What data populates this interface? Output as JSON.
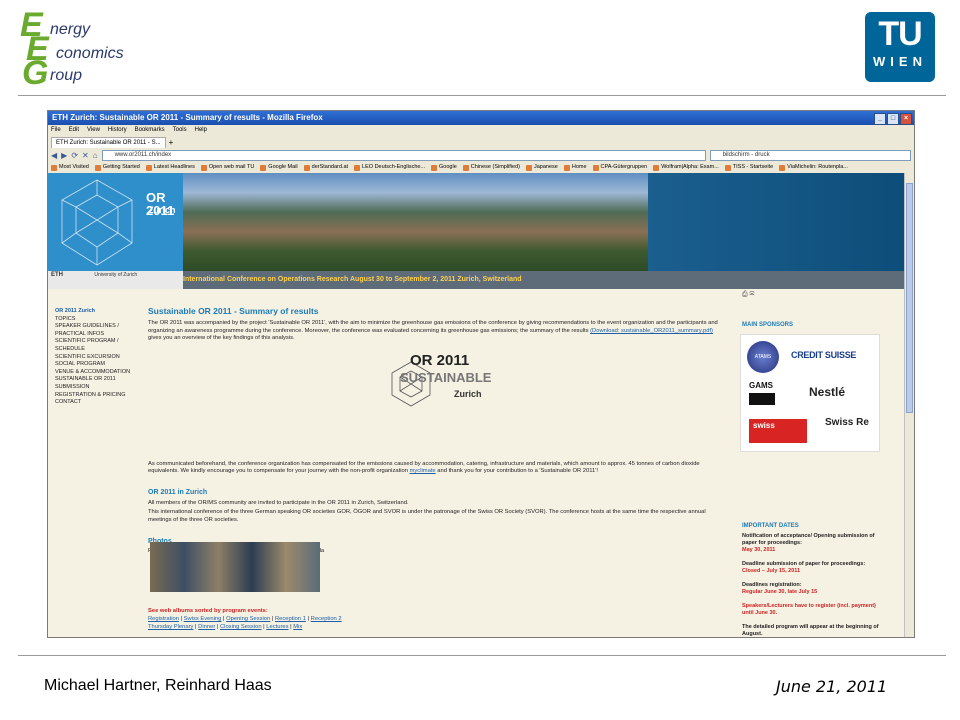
{
  "slide": {
    "logo_letters": [
      "E",
      "E",
      "G"
    ],
    "logo_words": [
      "nergy",
      "conomics",
      "roup"
    ],
    "tu_logo_top": "TU",
    "tu_logo_bottom": "WIEN",
    "authors": "Michael Hartner, Reinhard Haas",
    "date": "June 21, 2011"
  },
  "browser": {
    "window_title": "ETH Zurich: Sustainable OR 2011 - Summary of results - Mozilla Firefox",
    "window_buttons": [
      "_",
      "□",
      "×"
    ],
    "menu": [
      "File",
      "Edit",
      "View",
      "History",
      "Bookmarks",
      "Tools",
      "Help"
    ],
    "tab_label": "ETH Zurich: Sustainable OR 2011 - S...",
    "tab_add": "+",
    "nav_buttons": [
      "◀",
      "▶",
      "⟳",
      "✕",
      "⌂"
    ],
    "url": "www.or2011.ch/index",
    "search": "bildschirm - druck",
    "bookmarks": [
      "Most Visited",
      "Getting Started",
      "Latest Headlines",
      "Open web mail TU",
      "Google Mail",
      "derStandard.at",
      "LEO Deutsch-Englische...",
      "Google",
      "Chinese (Simplified)",
      "Japanese",
      "Home",
      "CPA-Gütergruppen",
      "Wolfram|Alpha: Exam...",
      "TISS - Startseite",
      "ViaMichelin: Routenpla..."
    ]
  },
  "site": {
    "logo_title": "OR 2011",
    "logo_sub": "Zurich",
    "eth_label": "ETH",
    "uzh_label": "University of Zurich",
    "conference_line": "International Conference on Operations Research   August 30 to September 2, 2011   Zurich, Switzerland",
    "nav": [
      "OR 2011 Zurich",
      "TOPICS",
      "SPEAKER GUIDELINES / PRACTICAL INFOS",
      "SCIENTIFIC PROGRAM / SCHEDULE",
      "SCIENTIFIC EXCURSION",
      "SOCIAL PROGRAM",
      "VENUE & ACCOMMODATION",
      "SUSTAINABLE OR 2011",
      "SUBMISSION",
      "REGISTRATION & PRICING",
      "CONTACT"
    ],
    "main_title": "Sustainable OR 2011 - Summary of results",
    "intro_text": "The OR 2011 was accompanied by the project 'Sustainable OR 2011', with the aim to minimize the greenhouse gas emissions of the conference by giving recommendations to the event organization and the participants and organizing an awareness programme during the conference. Moreover, the conference was evaluated concerning its greenhouse gas emissions; the summary of the results",
    "download_link": "(Download: sustainable_OR2011_summary.pdf)",
    "intro_text_2": "gives you an overview of the key findings of this analysis.",
    "sustainable_logo_top": "OR 2011",
    "sustainable_logo_mid": "SUSTAINABLE",
    "sustainable_logo_bottom": "Zurich",
    "comp_text": "As communicated beforehand, the conference organization has compensated for the emissions caused by accommodation, catering, infrastructure and materials, which amount to approx. 45 tonnes of carbon dioxide equivalents. We kindly encourage you to compensate for your journey with the non-profit organization",
    "myclimate": "myclimate",
    "comp_text_2": "and thank you for your contribution to a 'Sustainable OR 2011'!",
    "section2_title": "OR 2011 in Zurich",
    "section2_p1": "All members of the OR/MS community are invited to participate in the OR 2011 in Zurich, Switzerland.",
    "section2_p2": "This international conference of the three German speaking OR societies GOR, ÖGOR and SVOR is under the patronage of the Swiss OR Society (SVOR). The conference hosts at the same time the respective annual meetings of the three OR societies.",
    "photos_title": "Photos",
    "photos_credit": "Photos: Christina Buchmann | Photos Dozentenfoyer: Komei Fukuda",
    "albums_label": "See web albums sorted by program events:",
    "albums_line1": [
      "Registration",
      "Swiss Evening",
      "Opening Session",
      "Reception 1",
      "Reception 2"
    ],
    "albums_line2": [
      "Thursday Plenary",
      "Dinner",
      "Closing Session",
      "Lectures",
      "Mix"
    ],
    "print_icons": "⎙ ✉",
    "sponsors_title": "MAIN SPONSORS",
    "sponsors": [
      "ATAMS",
      "CREDIT SUISSE",
      "GAMS",
      "Nestlé",
      "swiss",
      "Swiss Re"
    ],
    "dates_title": "IMPORTANT DATES",
    "dates": [
      {
        "label": "Notification of acceptance/ Opening submission of paper for proceedings:",
        "value": "May 30, 2011"
      },
      {
        "label": "Deadline submission of paper for proceedings:",
        "value": "Closed – July 15, 2011"
      },
      {
        "label": "Deadlines registration:",
        "value": "Regular June 30, late July 15"
      },
      {
        "label": "",
        "value": "Speakers/Lecturers have to register (incl. payment) until June 30."
      },
      {
        "label": "The detailed program will appear at the beginning of August.",
        "value": ""
      }
    ]
  },
  "colors": {
    "eeg_green": "#6aaa2e",
    "eeg_blue": "#2b3a6b",
    "tu_blue": "#006699",
    "site_blue": "#1d7bb8",
    "page_bg": "#f5f1e3",
    "highlight_red": "#cc2222"
  }
}
